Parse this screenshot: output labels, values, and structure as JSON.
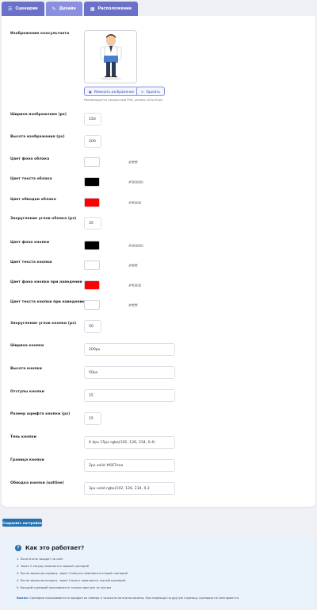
{
  "tabs": [
    {
      "label": "Сценарии",
      "icon": "list-icon"
    },
    {
      "label": "Дизайн",
      "icon": "brush-icon"
    },
    {
      "label": "Расположение",
      "icon": "layout-icon"
    }
  ],
  "image_section": {
    "label": "Изображение консультанта",
    "change_button": "Изменить изображение",
    "delete_button": "Удалить",
    "hint": "Рекомендуется прозрачный PNG, размер 100x100px"
  },
  "fields": {
    "image_width": {
      "label": "Ширина изображения (px)",
      "value": "150"
    },
    "image_height": {
      "label": "Высота изображения (px)",
      "value": "200"
    },
    "bubble_bg": {
      "label": "Цвет фона облака",
      "value": "#ffffff"
    },
    "bubble_text": {
      "label": "Цвет текста облака",
      "value": "#000000"
    },
    "bubble_border": {
      "label": "Цвет обводки облака",
      "value": "#ff0000"
    },
    "bubble_radius": {
      "label": "Закругление углов облака (px)",
      "value": "35"
    },
    "button_bg": {
      "label": "Цвет фона кнопки",
      "value": "#000000"
    },
    "button_text": {
      "label": "Цвет текста кнопки",
      "value": "#ffffff"
    },
    "button_hover_bg": {
      "label": "Цвет фона кнопки при наведении",
      "value": "#ff0000"
    },
    "button_hover_text": {
      "label": "Цвет текста кнопки при наведении",
      "value": "#ffffff"
    },
    "button_radius": {
      "label": "Закругление углов кнопки (px)",
      "value": "50"
    },
    "button_width": {
      "label": "Ширина кнопки",
      "value": "200px"
    },
    "button_height": {
      "label": "Высота кнопки",
      "value": "50px"
    },
    "button_padding": {
      "label": "Отступы кнопки",
      "value": "15"
    },
    "button_font_size": {
      "label": "Размер шрифта кнопки (px)",
      "value": "15"
    },
    "button_shadow": {
      "label": "Тень кнопки",
      "value": "0 4px 15px rgba(102, 126, 234, 0.4)"
    },
    "button_border": {
      "label": "Граница кнопки",
      "value": "2px solid #667eea"
    },
    "button_outline": {
      "label": "Обводка кнопки (outline)",
      "value": "3px solid rgba(102, 126, 234, 0.2"
    }
  },
  "colors": {
    "bubble_bg": "#ffffff",
    "bubble_text": "#000000",
    "bubble_border": "#ff0000",
    "button_bg": "#000000",
    "button_text": "#ffffff",
    "button_hover_bg": "#ff0000",
    "button_hover_text": "#ffffff"
  },
  "save_button": "Сохранить настройки",
  "how_it_works": {
    "title": "Как это работает?",
    "steps": [
      "1. Посетитель заходит на сайт",
      "2. Через 2 секунд появляется первый сценарий",
      "3. После закрытия сервиса, через 3 минуты появляется второй сценарий",
      "4. После закрытия второго, через 3 минут появляется третий сценарий",
      "5. Каждый сценарий показывается только один раз за сессию"
    ],
    "note_label": "Важно:",
    "note_text": "Сценарии показываются в порядке их номера и только если они включены. При переходе на другую страницу сценарии не повторяются."
  }
}
